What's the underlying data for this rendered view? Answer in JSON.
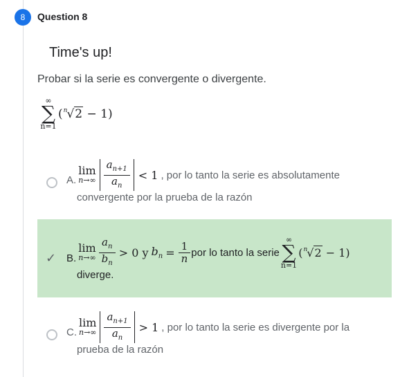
{
  "question": {
    "number": "8",
    "title": "Question 8",
    "status": "Time's up!",
    "prompt": "Probar si la serie es convergente o divergente."
  },
  "series": {
    "sum_upper": "∞",
    "sum_lower": "n=1",
    "radical_index": "n",
    "radicand": "2",
    "minus_one": " − 1)"
  },
  "options": [
    {
      "letter": "A.",
      "lim_sub": "n→∞",
      "frac_num": "a",
      "frac_num_sub": "n+1",
      "frac_den": "a",
      "frac_den_sub": "n",
      "relation": "< 1",
      "text_line1": ", por lo tanto la serie es absolutamente",
      "text_line2": "convergente por la prueba de la razón",
      "correct": false
    },
    {
      "letter": "B.",
      "lim_sub": "n→∞",
      "frac_num": "a",
      "frac_num_sub": "n",
      "frac_den": "b",
      "frac_den_sub": "n",
      "relation": "> 0 y",
      "b_eq": "b",
      "b_sub": "n",
      "b_rhs_num": "1",
      "b_rhs_den": "n",
      "text_mid": " por lo tanto la serie ",
      "text_line2": "diverge.",
      "correct": true
    },
    {
      "letter": "C.",
      "lim_sub": "n→∞",
      "frac_num": "a",
      "frac_num_sub": "n+1",
      "frac_den": "a",
      "frac_den_sub": "n",
      "relation": "> 1",
      "text_line1": ", por lo tanto la serie es divergente por la",
      "text_line2": "prueba de la razón",
      "correct": false
    }
  ],
  "labels": {
    "lim": "lim",
    "open_paren": "(",
    "equals": "="
  }
}
